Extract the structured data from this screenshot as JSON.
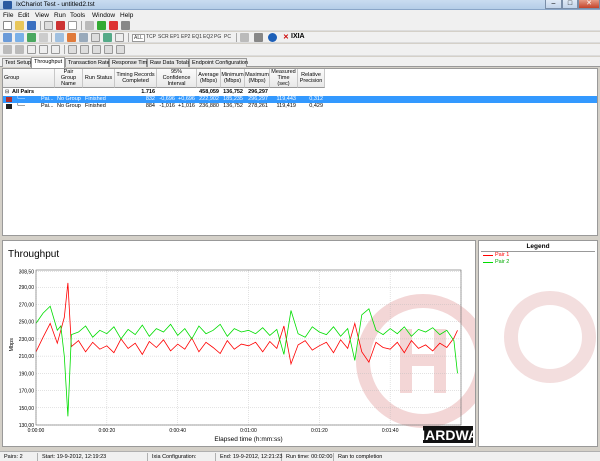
{
  "window": {
    "title": "IxChariot Test - untitled2.tst",
    "min": "–",
    "max": "□",
    "close": "✕"
  },
  "menu": [
    "File",
    "Edit",
    "View",
    "Run",
    "Tools",
    "Window",
    "Help"
  ],
  "toolbar": {
    "protocol_buttons": [
      "ALL",
      "TCP",
      "SCR",
      "EP1",
      "EP2",
      "EQ1",
      "EQ2",
      "PG",
      "PC"
    ],
    "brand": "IXIA"
  },
  "tabs": [
    "Test Setup",
    "Throughput",
    "Transaction Rate",
    "Response Time",
    "Raw Data Totals",
    "Endpoint Configuration"
  ],
  "active_tab": "Throughput",
  "grid": {
    "headers": [
      "Group",
      "Pair Group Name",
      "Run Status",
      "Timing Records Completed",
      "95% Confidence Interval",
      "Average (Mbps)",
      "Minimum (Mbps)",
      "Maximum (Mbps)",
      "Measured Time (sec)",
      "Relative Precision"
    ],
    "all_pairs": {
      "label": "All Pairs",
      "records": "1.716",
      "average": "458,059",
      "minimum": "136,752",
      "maximum": "296,297"
    },
    "rows": [
      {
        "pair": "Pai...",
        "group": "No Group",
        "status": "Finished",
        "records": "832",
        "ci_low": "-0,696",
        "ci_high": "+0,696",
        "average": "222,902",
        "minimum": "185,235",
        "maximum": "296,297",
        "time": "119,443",
        "precision": "0,312"
      },
      {
        "pair": "Pai...",
        "group": "No Group",
        "status": "Finished",
        "records": "884",
        "ci_low": "-1,016",
        "ci_high": "+1,016",
        "average": "236,880",
        "minimum": "136,752",
        "maximum": "278,261",
        "time": "119,419",
        "precision": "0,429"
      }
    ]
  },
  "chart_data": {
    "type": "line",
    "title": "Throughput",
    "xlabel": "Elapsed time (h:mm:ss)",
    "ylabel": "Mbps",
    "ylim": [
      130,
      310
    ],
    "yticks": [
      "130,00",
      "150,00",
      "170,00",
      "190,00",
      "210,00",
      "230,00",
      "250,00",
      "270,00",
      "290,00",
      "308,50"
    ],
    "ytick_values": [
      130,
      150,
      170,
      190,
      210,
      230,
      250,
      270,
      290,
      308.5
    ],
    "xlim": [
      0,
      120
    ],
    "xticks": [
      "0:00:00",
      "0:00:20",
      "0:00:40",
      "0:01:00",
      "0:01:20",
      "0:01:40",
      "0:02:00"
    ],
    "xtick_values": [
      0,
      20,
      40,
      60,
      80,
      100,
      120
    ],
    "grid": true,
    "legend_position": "right-panel",
    "series": [
      {
        "name": "Pair 1",
        "color": "#ff0000",
        "x": [
          0,
          2,
          4,
          6,
          7,
          8,
          9,
          10,
          12,
          14,
          16,
          18,
          20,
          22,
          24,
          26,
          28,
          30,
          32,
          34,
          36,
          38,
          40,
          42,
          44,
          46,
          48,
          50,
          52,
          54,
          56,
          58,
          60,
          62,
          64,
          66,
          68,
          70,
          72,
          74,
          76,
          78,
          80,
          82,
          84,
          86,
          88,
          90,
          92,
          94,
          96,
          98,
          100,
          102,
          104,
          106,
          108,
          110,
          112,
          114,
          116,
          118,
          119
        ],
        "y": [
          215,
          232,
          248,
          225,
          240,
          255,
          295,
          221,
          228,
          215,
          226,
          218,
          222,
          214,
          230,
          219,
          225,
          212,
          227,
          220,
          229,
          216,
          224,
          218,
          231,
          215,
          226,
          220,
          213,
          228,
          218,
          224,
          222,
          226,
          215,
          227,
          219,
          245,
          201,
          223,
          228,
          217,
          222,
          226,
          214,
          229,
          219,
          248,
          215,
          203,
          226,
          220,
          218,
          226,
          214,
          228,
          219,
          223,
          216,
          225,
          220,
          231,
          240
        ]
      },
      {
        "name": "Pair 2",
        "color": "#00dd00",
        "x": [
          0,
          2,
          4,
          6,
          7,
          8,
          9,
          10,
          12,
          14,
          16,
          18,
          20,
          22,
          24,
          26,
          28,
          30,
          32,
          34,
          36,
          38,
          40,
          42,
          44,
          46,
          48,
          50,
          52,
          54,
          56,
          58,
          60,
          62,
          64,
          66,
          68,
          70,
          72,
          74,
          76,
          78,
          80,
          82,
          84,
          86,
          88,
          90,
          92,
          94,
          96,
          98,
          100,
          102,
          104,
          106,
          108,
          110,
          112,
          114,
          116,
          118,
          119
        ],
        "y": [
          248,
          260,
          268,
          240,
          245,
          210,
          140,
          235,
          238,
          245,
          232,
          240,
          236,
          244,
          230,
          241,
          235,
          246,
          233,
          242,
          238,
          247,
          234,
          242,
          230,
          245,
          236,
          240,
          247,
          233,
          242,
          238,
          240,
          236,
          243,
          234,
          241,
          212,
          263,
          236,
          232,
          244,
          238,
          235,
          244,
          233,
          242,
          205,
          258,
          265,
          240,
          235,
          242,
          236,
          244,
          233,
          241,
          238,
          243,
          235,
          240,
          228,
          190
        ]
      }
    ]
  },
  "legend": {
    "title": "Legend",
    "items": [
      "Pair 1",
      "Pair 2"
    ]
  },
  "watermark": "HARDWARE.INFO",
  "status": {
    "pairs": "Pairs: 2",
    "start": "Start: 19-9-2012, 12:19:23",
    "ixia_config": "Ixia Configuration:",
    "end": "End: 19-9-2012, 12:21:23",
    "run_time": "Run time: 00:02:00",
    "completion": "Ran to completion"
  }
}
